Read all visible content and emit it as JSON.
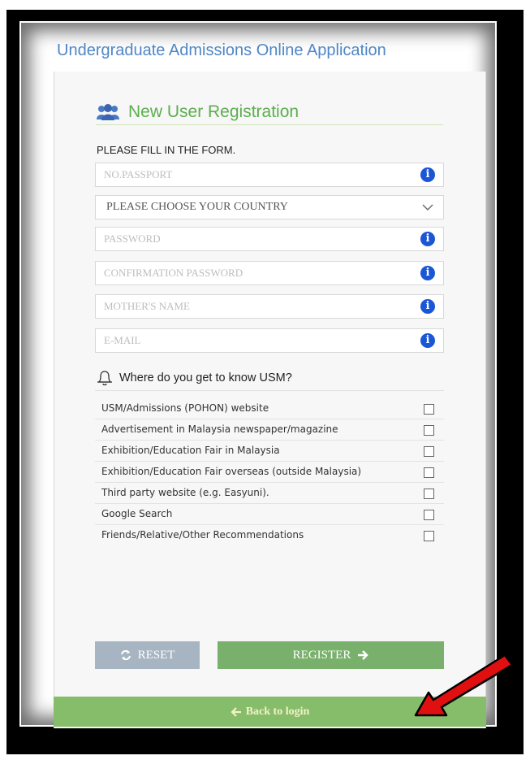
{
  "header": {
    "title": "Undergraduate Admissions Online Application"
  },
  "registration": {
    "title": "New User Registration",
    "instruction": "PLEASE FILL IN THE FORM."
  },
  "fields": {
    "passport_placeholder": "NO.PASSPORT",
    "country_value": "PLEASE CHOOSE YOUR COUNTRY",
    "password_placeholder": "PASSWORD",
    "confirm_password_placeholder": "CONFIRMATION PASSWORD",
    "mother_name_placeholder": "MOTHER'S NAME",
    "email_placeholder": "E-MAIL"
  },
  "survey": {
    "question": "Where do you get to know USM?",
    "options": [
      "USM/Admissions (POHON) website",
      "Advertisement in Malaysia newspaper/magazine",
      "Exhibition/Education Fair in Malaysia",
      "Exhibition/Education Fair overseas (outside Malaysia)",
      "Third party website (e.g. Easyuni).",
      "Google Search",
      " Friends/Relative/Other Recommendations"
    ]
  },
  "buttons": {
    "reset_label": "RESET",
    "register_label": "REGISTER",
    "back_label": "Back to login"
  },
  "icons": {
    "users": "users-icon",
    "info": "info-icon",
    "bell": "bell-icon",
    "refresh": "refresh-icon",
    "arrow_right": "arrow-right-icon",
    "arrow_left": "arrow-left-icon"
  },
  "colors": {
    "accent_green": "#5cae4e",
    "register_green": "#79b06b",
    "back_bar": "#86bd6b",
    "reset_gray": "#a7b5c2",
    "info_blue": "#1a56d6",
    "title_blue": "#4f86c6",
    "annotation_red": "#e01010"
  }
}
